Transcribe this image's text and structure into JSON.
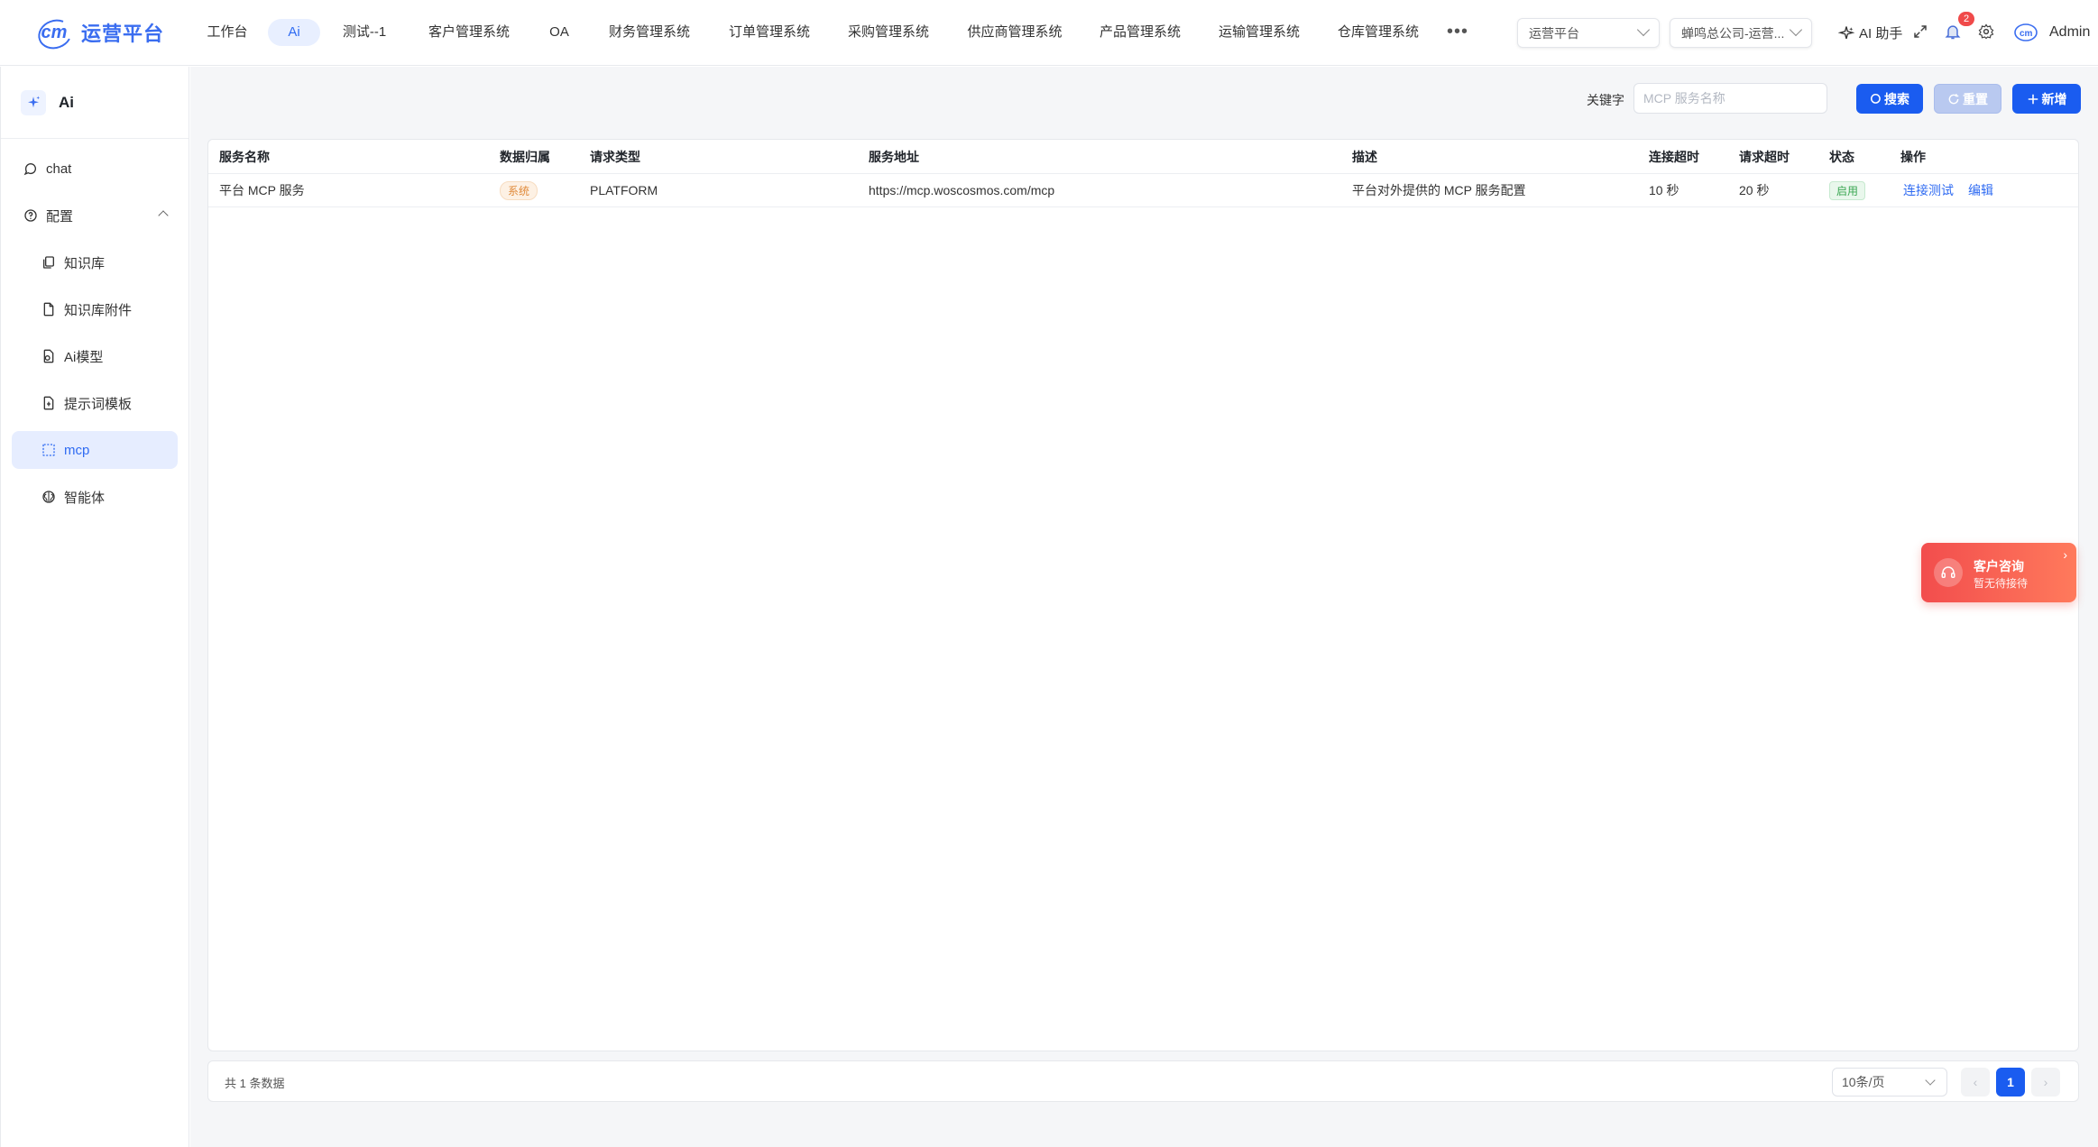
{
  "brand": {
    "title": "运营平台"
  },
  "nav": {
    "items": [
      "工作台",
      "Ai",
      "测试--1",
      "客户管理系统",
      "OA",
      "财务管理系统",
      "订单管理系统",
      "采购管理系统",
      "供应商管理系统",
      "产品管理系统",
      "运输管理系统",
      "仓库管理系统"
    ],
    "active": "Ai",
    "more": "•••"
  },
  "header": {
    "platform_select": "运营平台",
    "company_select": "蝉鸣总公司-运营...",
    "ai_helper": "AI 助手",
    "notification_count": "2",
    "user_name": "Admin"
  },
  "sidebar": {
    "title": "Ai",
    "items": [
      {
        "label": "chat",
        "icon": "chat-bubble-icon"
      },
      {
        "label": "配置",
        "icon": "question-circle-icon"
      },
      {
        "label": "知识库",
        "icon": "book-copy-icon"
      },
      {
        "label": "知识库附件",
        "icon": "file-icon"
      },
      {
        "label": "Ai模型",
        "icon": "model-file-icon"
      },
      {
        "label": "提示词模板",
        "icon": "template-file-icon"
      },
      {
        "label": "mcp",
        "icon": "dashed-square-icon"
      },
      {
        "label": "智能体",
        "icon": "brain-icon"
      }
    ],
    "active": "mcp"
  },
  "search": {
    "keyword_label": "关键字",
    "keyword_placeholder": "MCP 服务名称",
    "search_label": "搜索",
    "reset_label": "重置",
    "add_label": "新增"
  },
  "table": {
    "columns": [
      "服务名称",
      "数据归属",
      "请求类型",
      "服务地址",
      "描述",
      "连接超时",
      "请求超时",
      "状态",
      "操作"
    ],
    "rows": [
      {
        "name": "平台 MCP 服务",
        "owner": "系统",
        "request_type": "PLATFORM",
        "url": "https://mcp.woscosmos.com/mcp",
        "description": "平台对外提供的 MCP 服务配置",
        "connect_timeout": "10 秒",
        "request_timeout": "20 秒",
        "status": "启用",
        "actions": [
          "连接测试",
          "编辑"
        ]
      }
    ]
  },
  "pagination": {
    "total_text": "共 1 条数据",
    "page_size": "10条/页",
    "current_page": "1",
    "prev": "‹",
    "next": "›"
  },
  "consult": {
    "title": "客户咨询",
    "subtitle": "暂无待接待",
    "close": "›"
  },
  "colors": {
    "primary": "#1a5cf0",
    "accent_light": "#e6edff",
    "danger": "#f04a4a"
  }
}
